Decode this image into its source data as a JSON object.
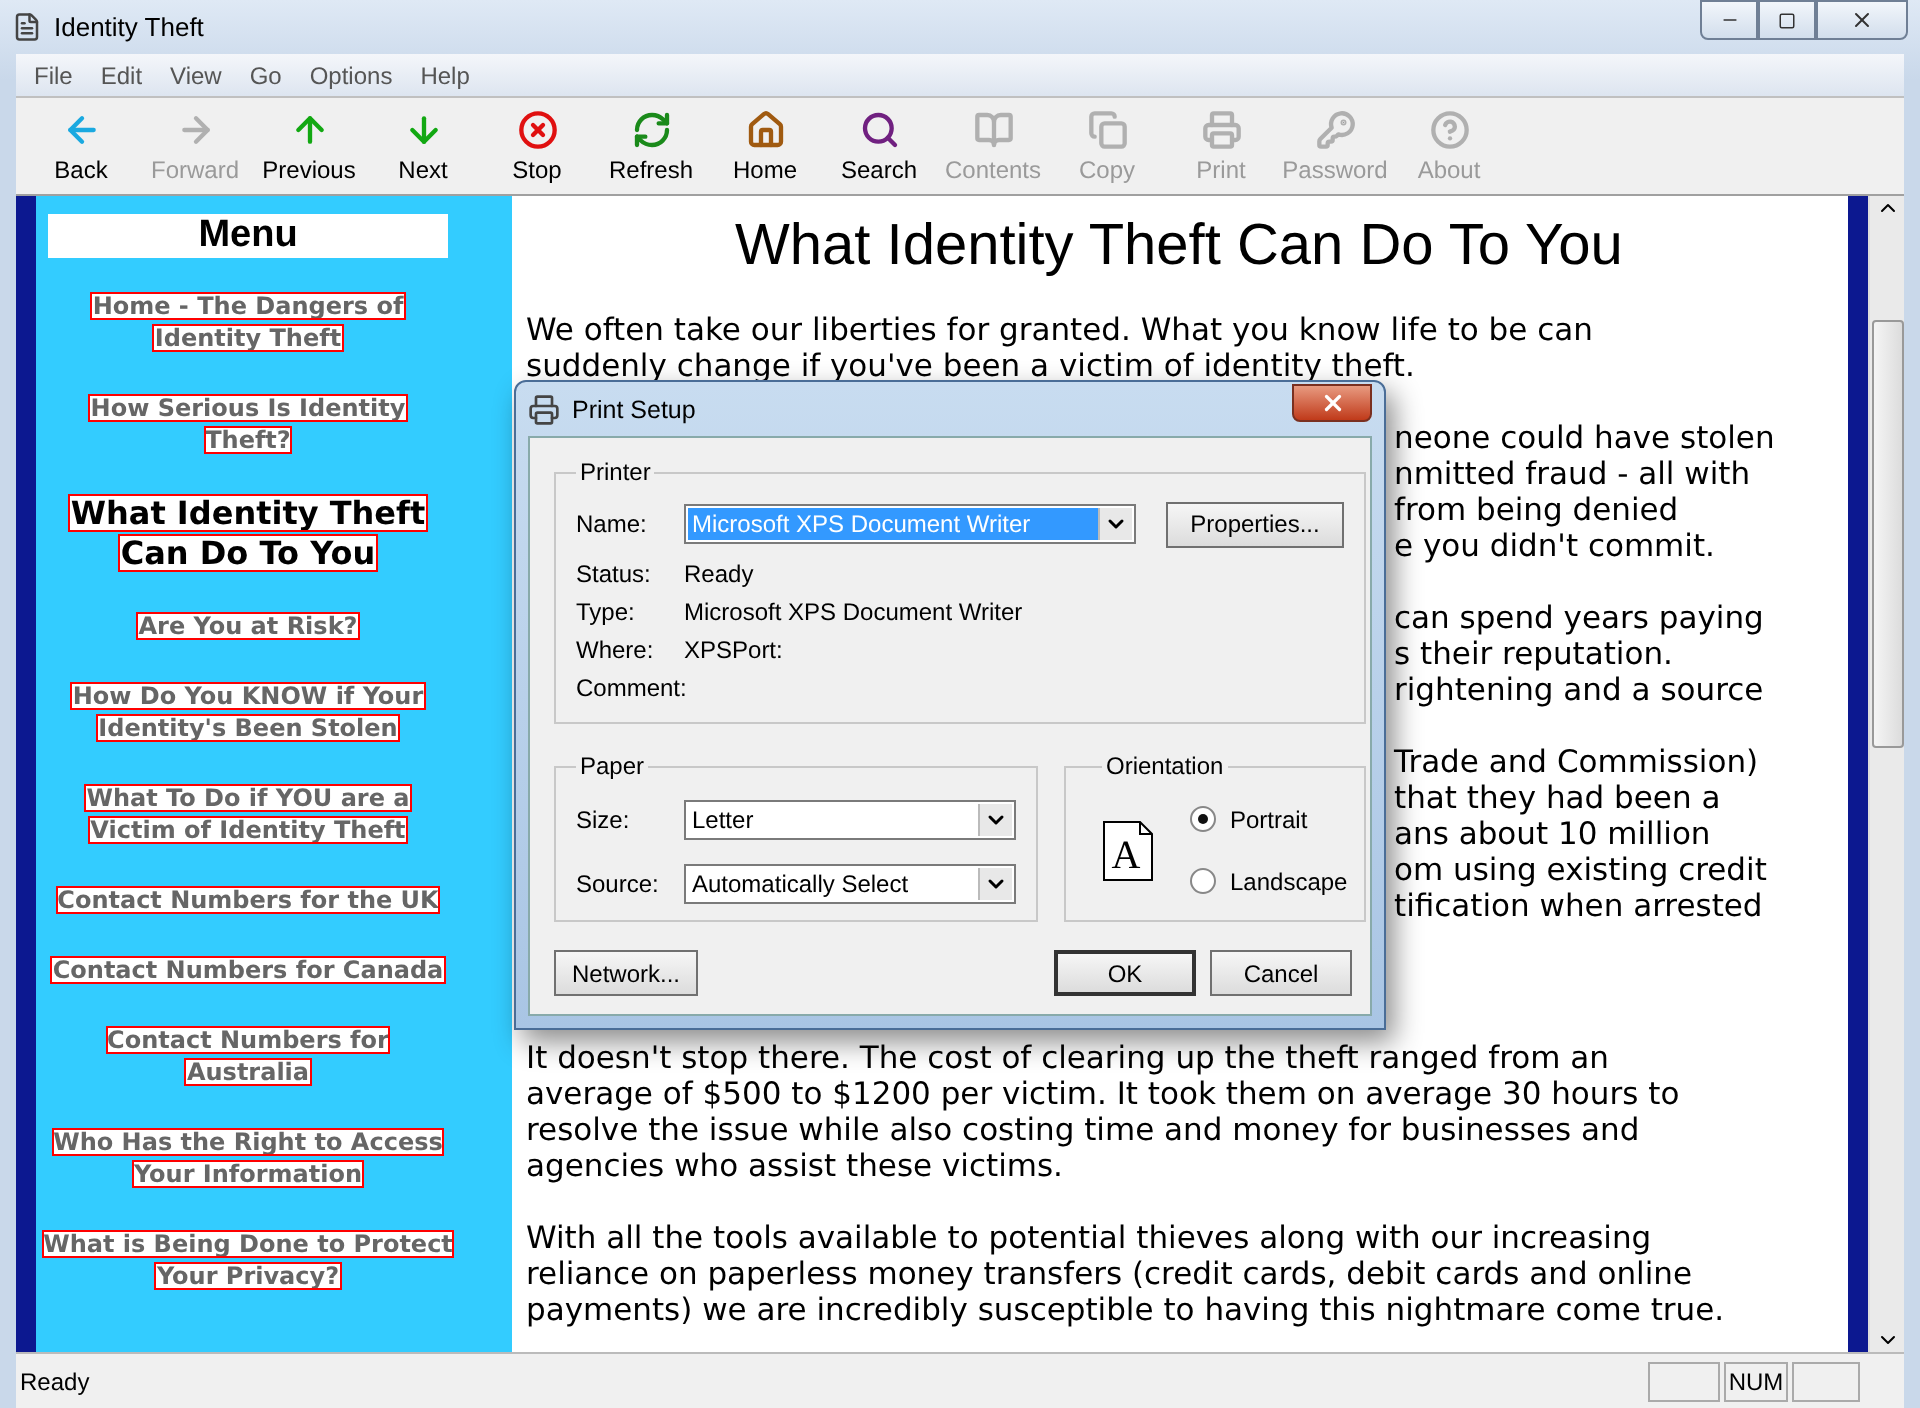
{
  "window": {
    "title": "Identity Theft"
  },
  "menu_bar": [
    "File",
    "Edit",
    "View",
    "Go",
    "Options",
    "Help"
  ],
  "toolbar": [
    {
      "label": "Back",
      "kind": "back",
      "disabled": false
    },
    {
      "label": "Forward",
      "kind": "forward",
      "disabled": true
    },
    {
      "label": "Previous",
      "kind": "previous",
      "disabled": false
    },
    {
      "label": "Next",
      "kind": "next",
      "disabled": false
    },
    {
      "label": "Stop",
      "kind": "stop",
      "disabled": false
    },
    {
      "label": "Refresh",
      "kind": "refresh",
      "disabled": false
    },
    {
      "label": "Home",
      "kind": "home",
      "disabled": false
    },
    {
      "label": "Search",
      "kind": "search",
      "disabled": false
    },
    {
      "label": "Contents",
      "kind": "contents",
      "disabled": true
    },
    {
      "label": "Copy",
      "kind": "copy",
      "disabled": true
    },
    {
      "label": "Print",
      "kind": "print",
      "disabled": true
    },
    {
      "label": "Password",
      "kind": "password",
      "disabled": true
    },
    {
      "label": "About",
      "kind": "about",
      "disabled": true
    }
  ],
  "sidebar": {
    "title": "Menu",
    "items": [
      {
        "lines": [
          "Home - The Dangers of",
          "Identity Theft"
        ],
        "selected": false
      },
      {
        "lines": [
          "How Serious Is Identity",
          "Theft?"
        ],
        "selected": false
      },
      {
        "lines": [
          "What Identity Theft",
          "Can Do To You"
        ],
        "selected": true
      },
      {
        "lines": [
          "Are You at Risk?"
        ],
        "selected": false
      },
      {
        "lines": [
          "How Do You KNOW if Your",
          "Identity's Been Stolen"
        ],
        "selected": false
      },
      {
        "lines": [
          "What To Do if YOU are a",
          "Victim of Identity Theft"
        ],
        "selected": false
      },
      {
        "lines": [
          "Contact Numbers for the UK"
        ],
        "selected": false
      },
      {
        "lines": [
          "Contact Numbers for Canada"
        ],
        "selected": false
      },
      {
        "lines": [
          "Contact Numbers for",
          "Australia"
        ],
        "selected": false
      },
      {
        "lines": [
          "Who Has the Right to Access",
          "Your Information"
        ],
        "selected": false
      },
      {
        "lines": [
          "What is Being Done to Protect",
          "Your Privacy?"
        ],
        "selected": false
      }
    ]
  },
  "content": {
    "heading": "What Identity Theft Can Do To You",
    "paragraphs": [
      {
        "lines": [
          {
            "text": "We often take our liberties for granted. What you know life to be can",
            "kind": "full"
          },
          {
            "text": "suddenly change if you've been a victim of identity theft.",
            "kind": "full"
          }
        ]
      },
      {
        "lines": [
          {
            "text": "neone could have stolen",
            "kind": "tail"
          },
          {
            "text": "nmitted fraud - all with",
            "kind": "tail"
          },
          {
            "text": "from being denied",
            "kind": "tail"
          },
          {
            "text": "e you didn't commit.",
            "kind": "tail"
          }
        ]
      },
      {
        "lines": [
          {
            "text": "can spend years paying",
            "kind": "tail"
          },
          {
            "text": "s their reputation.",
            "kind": "tail"
          },
          {
            "text": "rightening and a source",
            "kind": "tail"
          }
        ]
      },
      {
        "lines": [
          {
            "text": "Trade and Commission)",
            "kind": "tail"
          },
          {
            "text": "that they had been a",
            "kind": "tail"
          },
          {
            "text": "ans about 10 million",
            "kind": "tail"
          },
          {
            "text": "om using existing credit",
            "kind": "tail"
          },
          {
            "text": "tification when arrested",
            "kind": "tail"
          }
        ]
      },
      {
        "lines": [
          {
            "text": "It doesn't stop there. The cost of clearing up the theft ranged from an",
            "kind": "full"
          },
          {
            "text": "average of $500 to $1200 per victim. It took them on average 30 hours to",
            "kind": "full"
          },
          {
            "text": "resolve the issue while also costing time and money for businesses and",
            "kind": "full"
          },
          {
            "text": "agencies who assist these victims.",
            "kind": "full"
          }
        ]
      },
      {
        "lines": [
          {
            "text": "With all the tools available to potential thieves along with our increasing",
            "kind": "full"
          },
          {
            "text": "reliance on paperless money transfers (credit cards, debit cards and online",
            "kind": "full"
          },
          {
            "text": "payments) we are incredibly susceptible to having this nightmare come true.",
            "kind": "full"
          }
        ]
      }
    ]
  },
  "dialog": {
    "title": "Print Setup",
    "printer": {
      "group": "Printer",
      "name_label": "Name:",
      "name_value": "Microsoft XPS Document Writer",
      "properties_button": "Properties...",
      "info": [
        {
          "label": "Status:",
          "value": "Ready"
        },
        {
          "label": "Type:",
          "value": "Microsoft XPS Document Writer"
        },
        {
          "label": "Where:",
          "value": "XPSPort:"
        },
        {
          "label": "Comment:"
        }
      ]
    },
    "paper": {
      "group": "Paper",
      "fields": [
        {
          "label": "Size:",
          "value": "Letter"
        },
        {
          "label": "Source:",
          "value": "Automatically Select"
        }
      ]
    },
    "orientation": {
      "group": "Orientation",
      "page_glyph": "A",
      "options": [
        {
          "label": "Portrait",
          "selected": true
        },
        {
          "label": "Landscape",
          "selected": false
        }
      ]
    },
    "network_button": "Network...",
    "buttons": [
      {
        "label": "OK",
        "default": true
      },
      {
        "label": "Cancel",
        "default": false
      }
    ]
  },
  "status_bar": {
    "text": "Ready",
    "panels": [
      "NUM"
    ]
  }
}
